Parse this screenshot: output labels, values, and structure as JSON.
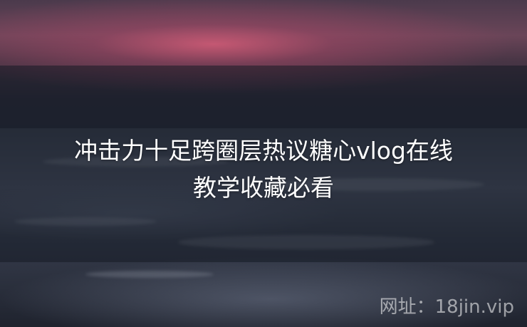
{
  "title_lines": [
    "冲击力十足跨圈层热议糖心vlog在线",
    "教学收藏必看"
  ],
  "watermark": "网址：18jin.vip",
  "colors": {
    "sky_glow": "#d65c78",
    "overlay": "#141822",
    "text": "#ffffff"
  }
}
